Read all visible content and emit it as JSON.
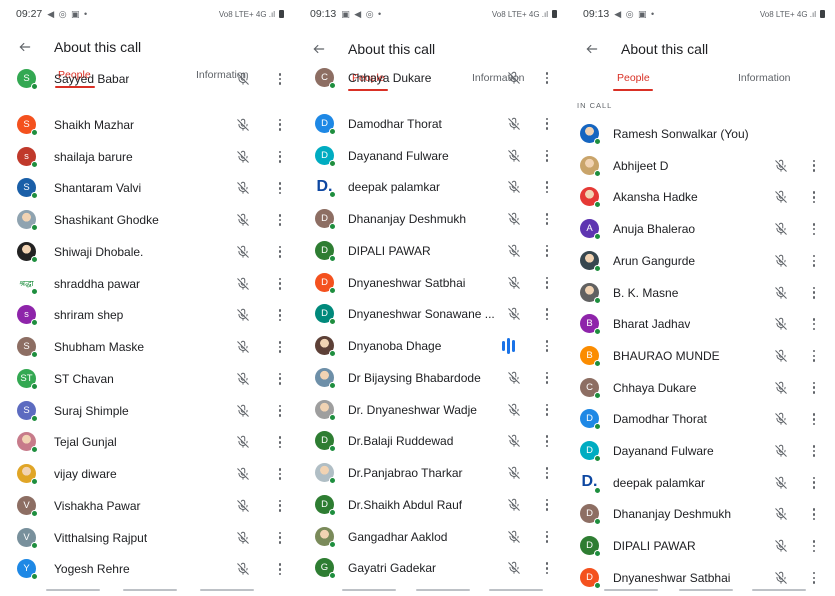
{
  "panels": [
    {
      "status": {
        "time": "09:27",
        "icons": "◀ ◎ ▣ •",
        "right": "Vo8 LTE+ 4G .ıl"
      },
      "title": "About this call",
      "tabs": {
        "people": "People",
        "information": "Information"
      },
      "section_label": "",
      "participants": [
        {
          "name": "Sayyed Babar",
          "initial": "S",
          "color": "#33a852",
          "avatar_type": "letter",
          "muted": true
        },
        {
          "name": "Shaikh Mazhar",
          "initial": "S",
          "color": "#f4511e",
          "avatar_type": "letter",
          "muted": true
        },
        {
          "name": "shailaja barure",
          "initial": "s",
          "color": "#c0392b",
          "avatar_type": "letter",
          "muted": true
        },
        {
          "name": "Shantaram Valvi",
          "initial": "S",
          "color": "#1a5fa8",
          "avatar_type": "letter",
          "muted": true
        },
        {
          "name": "Shashikant Ghodke",
          "initial": "",
          "color": "#8fa3b0",
          "avatar_type": "photo",
          "muted": true
        },
        {
          "name": "Shiwaji Dhobale.",
          "initial": "",
          "color": "#222222",
          "avatar_type": "photo",
          "muted": true
        },
        {
          "name": "shraddha pawar",
          "initial": "श्रद्धा",
          "color": "#ffffff",
          "avatar_type": "text",
          "muted": true
        },
        {
          "name": "shriram shep",
          "initial": "s",
          "color": "#8e24aa",
          "avatar_type": "letter",
          "muted": true
        },
        {
          "name": "Shubham Maske",
          "initial": "S",
          "color": "#8d6e63",
          "avatar_type": "letter",
          "muted": true
        },
        {
          "name": "ST Chavan",
          "initial": "ST",
          "color": "#33a852",
          "avatar_type": "letter",
          "muted": true
        },
        {
          "name": "Suraj Shimple",
          "initial": "S",
          "color": "#5c6bc0",
          "avatar_type": "letter",
          "muted": true
        },
        {
          "name": "Tejal Gunjal",
          "initial": "",
          "color": "#c77b8a",
          "avatar_type": "photo",
          "muted": true
        },
        {
          "name": "vijay diware",
          "initial": "",
          "color": "#e0a526",
          "avatar_type": "photo",
          "muted": true
        },
        {
          "name": "Vishakha Pawar",
          "initial": "V",
          "color": "#8d6e63",
          "avatar_type": "letter",
          "muted": true
        },
        {
          "name": "Vitthalsing Rajput",
          "initial": "V",
          "color": "#78909c",
          "avatar_type": "letter",
          "muted": true
        },
        {
          "name": "Yogesh Rehre",
          "initial": "Y",
          "color": "#1e88e5",
          "avatar_type": "letter",
          "muted": true
        }
      ]
    },
    {
      "status": {
        "time": "09:13",
        "icons": "▣ ◀ ◎ •",
        "right": "Vo8 LTE+ 4G .ıl"
      },
      "title": "About this call",
      "tabs": {
        "people": "People",
        "information": "Information"
      },
      "section_label": "",
      "participants": [
        {
          "name": "Chhaya Dukare",
          "initial": "C",
          "color": "#8d6e63",
          "avatar_type": "letter",
          "muted": true
        },
        {
          "name": "Damodhar Thorat",
          "initial": "D",
          "color": "#1e88e5",
          "avatar_type": "letter",
          "muted": true
        },
        {
          "name": "Dayanand Fulware",
          "initial": "D",
          "color": "#00acc1",
          "avatar_type": "letter",
          "muted": true
        },
        {
          "name": "deepak palamkar",
          "initial": "D.",
          "color": "#ffffff",
          "avatar_type": "bigD",
          "muted": true
        },
        {
          "name": "Dhananjay Deshmukh",
          "initial": "D",
          "color": "#8d6e63",
          "avatar_type": "letter",
          "muted": true
        },
        {
          "name": "DIPALI PAWAR",
          "initial": "D",
          "color": "#2e7d32",
          "avatar_type": "letter",
          "muted": true
        },
        {
          "name": "Dnyaneshwar Satbhai",
          "initial": "D",
          "color": "#f4511e",
          "avatar_type": "letter",
          "muted": true
        },
        {
          "name": "Dnyaneshwar Sonawane ...",
          "initial": "D",
          "color": "#00897b",
          "avatar_type": "letter",
          "muted": true
        },
        {
          "name": "Dnyanoba Dhage",
          "initial": "",
          "color": "#5d4037",
          "avatar_type": "photo",
          "muted": false
        },
        {
          "name": "Dr Bijaysing Bhabardode",
          "initial": "",
          "color": "#6d8fa8",
          "avatar_type": "photo",
          "muted": true
        },
        {
          "name": "Dr. Dnyaneshwar Wadje",
          "initial": "",
          "color": "#9e9e9e",
          "avatar_type": "photo",
          "muted": true
        },
        {
          "name": "Dr.Balaji Ruddewad",
          "initial": "D",
          "color": "#2e7d32",
          "avatar_type": "letter",
          "muted": true
        },
        {
          "name": "Dr.Panjabrao Tharkar",
          "initial": "",
          "color": "#b0bec5",
          "avatar_type": "photo",
          "muted": true
        },
        {
          "name": "Dr.Shaikh Abdul Rauf",
          "initial": "D",
          "color": "#2e7d32",
          "avatar_type": "letter",
          "muted": true
        },
        {
          "name": "Gangadhar Aaklod",
          "initial": "",
          "color": "#7a8a5a",
          "avatar_type": "photo",
          "muted": true
        },
        {
          "name": "Gayatri Gadekar",
          "initial": "G",
          "color": "#2e7d32",
          "avatar_type": "letter",
          "muted": true
        }
      ]
    },
    {
      "status": {
        "time": "09:13",
        "icons": "◀ ◎ ▣ •",
        "right": "Vo8 LTE+ 4G .ıl"
      },
      "title": "About this call",
      "tabs": {
        "people": "People",
        "information": "Information"
      },
      "section_label": "IN CALL",
      "participants": [
        {
          "name": "Ramesh Sonwalkar (You)",
          "initial": "",
          "color": "#1565c0",
          "avatar_type": "photo",
          "muted": false,
          "is_you": true
        },
        {
          "name": "Abhijeet D",
          "initial": "",
          "color": "#c9a46a",
          "avatar_type": "photo",
          "muted": true
        },
        {
          "name": "Akansha Hadke",
          "initial": "",
          "color": "#e53935",
          "avatar_type": "photo",
          "muted": true
        },
        {
          "name": "Anuja Bhalerao",
          "initial": "A",
          "color": "#5e35b1",
          "avatar_type": "letter",
          "muted": true
        },
        {
          "name": "Arun Gangurde",
          "initial": "",
          "color": "#37474f",
          "avatar_type": "photo",
          "muted": true
        },
        {
          "name": "B. K. Masne",
          "initial": "",
          "color": "#616161",
          "avatar_type": "photo",
          "muted": true
        },
        {
          "name": "Bharat Jadhav",
          "initial": "B",
          "color": "#8e24aa",
          "avatar_type": "letter",
          "muted": true
        },
        {
          "name": "BHAURAO MUNDE",
          "initial": "B",
          "color": "#fb8c00",
          "avatar_type": "letter",
          "muted": true
        },
        {
          "name": "Chhaya Dukare",
          "initial": "C",
          "color": "#8d6e63",
          "avatar_type": "letter",
          "muted": true
        },
        {
          "name": "Damodhar Thorat",
          "initial": "D",
          "color": "#1e88e5",
          "avatar_type": "letter",
          "muted": true
        },
        {
          "name": "Dayanand Fulware",
          "initial": "D",
          "color": "#00acc1",
          "avatar_type": "letter",
          "muted": true
        },
        {
          "name": "deepak palamkar",
          "initial": "D.",
          "color": "#ffffff",
          "avatar_type": "bigD",
          "muted": true
        },
        {
          "name": "Dhananjay Deshmukh",
          "initial": "D",
          "color": "#8d6e63",
          "avatar_type": "letter",
          "muted": true
        },
        {
          "name": "DIPALI PAWAR",
          "initial": "D",
          "color": "#2e7d32",
          "avatar_type": "letter",
          "muted": true
        },
        {
          "name": "Dnyaneshwar Satbhai",
          "initial": "D",
          "color": "#f4511e",
          "avatar_type": "letter",
          "muted": true
        }
      ]
    }
  ],
  "colors": {
    "accent": "#d93025",
    "online": "#1e8e3e",
    "speaking": "#1a73e8",
    "icon": "#5f6368"
  },
  "icons": {
    "back": "arrow-left-icon",
    "mute": "mic-off-icon",
    "more": "more-vert-icon",
    "speaking": "speaking-bars-icon"
  }
}
